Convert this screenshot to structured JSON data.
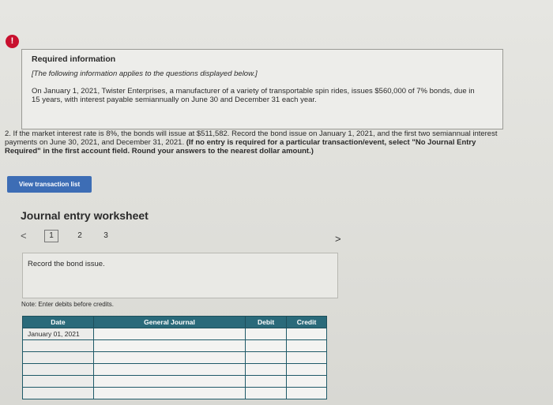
{
  "alert": {
    "glyph": "!"
  },
  "info": {
    "title": "Required information",
    "subtitle": "[The following information applies to the questions displayed below.]",
    "body": "On January 1, 2021, Twister Enterprises, a manufacturer of a variety of transportable spin rides, issues $560,000 of 7% bonds, due in 15 years, with interest payable semiannually on June 30 and December 31 each year."
  },
  "question": {
    "text": "2. If the market interest rate is 8%, the bonds will issue at $511,582. Record the bond issue on January 1, 2021, and the first two semiannual interest payments on June 30, 2021, and December 31, 2021.",
    "bold": "(If no entry is required for a particular transaction/event, select \"No Journal Entry Required\" in the first account field. Round your answers to the nearest dollar amount.)"
  },
  "buttons": {
    "view_transaction": "View transaction list"
  },
  "worksheet": {
    "title": "Journal entry worksheet",
    "pages": [
      "1",
      "2",
      "3"
    ],
    "prev_glyph": "<",
    "next_glyph": ">",
    "record_text": "Record the bond issue.",
    "note": "Note: Enter debits before credits."
  },
  "table": {
    "headers": {
      "date": "Date",
      "journal": "General Journal",
      "debit": "Debit",
      "credit": "Credit"
    },
    "rows": [
      {
        "date": "January 01, 2021"
      },
      {
        "date": ""
      },
      {
        "date": ""
      },
      {
        "date": ""
      },
      {
        "date": ""
      },
      {
        "date": ""
      }
    ]
  }
}
